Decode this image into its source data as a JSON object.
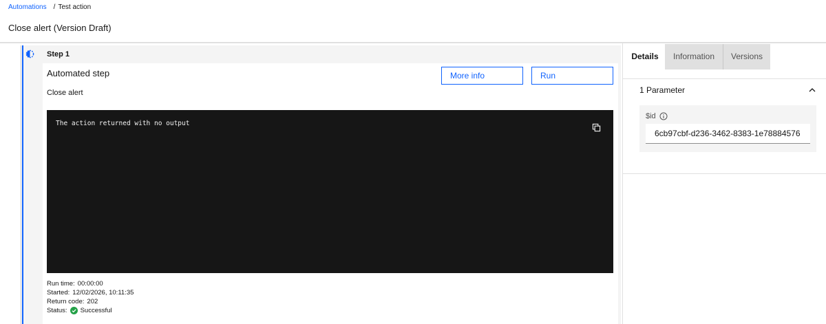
{
  "breadcrumb": {
    "root_label": "Automations",
    "separator": "/",
    "current_label": "Test action"
  },
  "page": {
    "title": "Close alert (Version Draft)"
  },
  "step": {
    "label": "Step 1",
    "type_label": "Automated step",
    "action_name": "Close alert",
    "more_info_label": "More info",
    "run_label": "Run",
    "status_icon": "half-filled-circle-icon"
  },
  "output": {
    "text": "The action returned with no output",
    "copy_icon": "copy-icon"
  },
  "run_meta": {
    "run_time_label": "Run time:",
    "run_time_value": "00:00:00",
    "started_label": "Started:",
    "started_value": "12/02/2026, 10:11:35",
    "return_code_label": "Return code:",
    "return_code_value": "202",
    "status_label": "Status:",
    "status_value": "Successful",
    "status_icon": "checkmark-circle-icon"
  },
  "side_panel": {
    "tabs": [
      {
        "label": "Details",
        "active": true
      },
      {
        "label": "Information",
        "active": false
      },
      {
        "label": "Versions",
        "active": false
      }
    ],
    "parameters_header": "1 Parameter",
    "parameters": [
      {
        "name": "$id",
        "value": "6cb97cbf-d236-3462-8383-1e78884576"
      }
    ]
  },
  "colors": {
    "accent": "#0f62fe",
    "terminal_bg": "#161616",
    "success": "#24a148"
  }
}
